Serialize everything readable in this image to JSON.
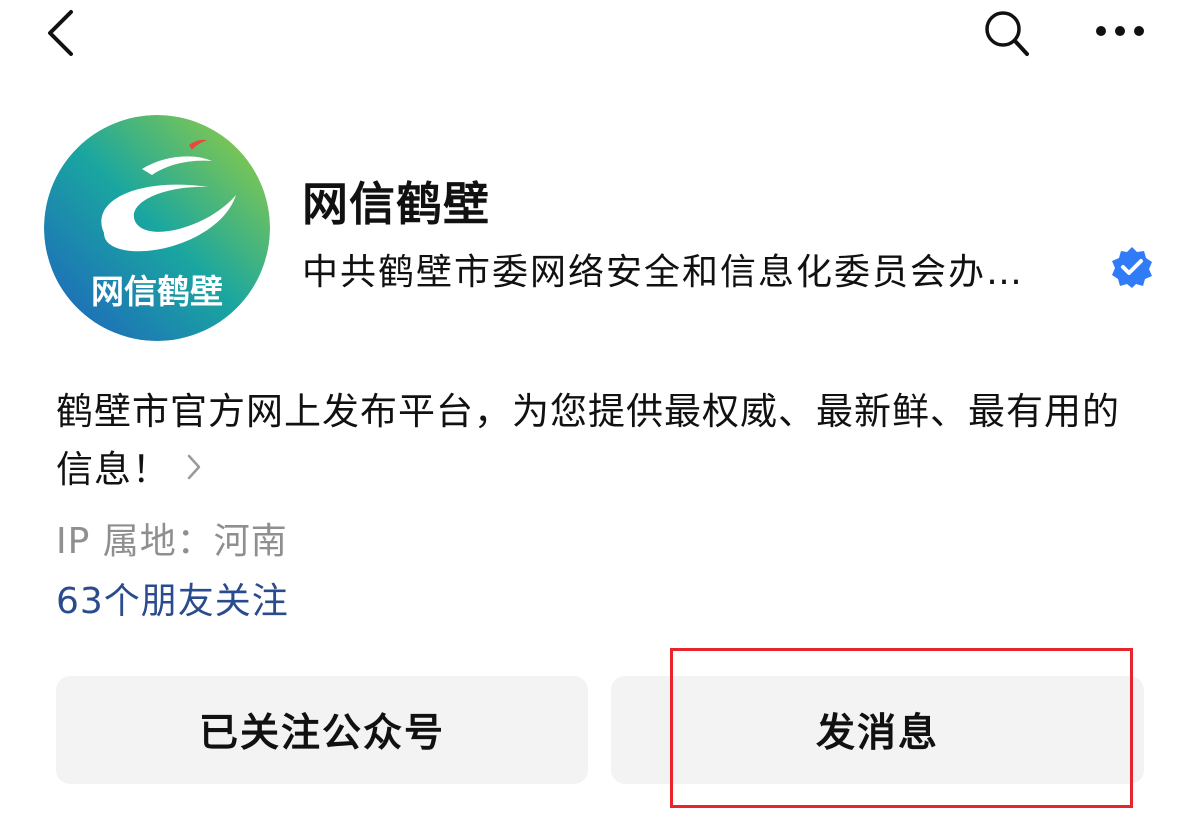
{
  "header": {
    "back_icon": "chevron-left-icon",
    "search_icon": "search-icon",
    "more_icon": "more-dots-icon"
  },
  "profile": {
    "avatar_text": "网信鹤壁",
    "name": "网信鹤壁",
    "owner": "中共鹤壁市委网络安全和信息化委员会办…",
    "verified_color": "#2f7cf6",
    "description": "鹤壁市官方网上发布平台，为您提供最权威、最新鲜、最有用的信息！",
    "ip_location": "IP 属地：河南",
    "friends_following": "63个朋友关注"
  },
  "actions": {
    "follow_label": "已关注公众号",
    "message_label": "发消息"
  },
  "colors": {
    "highlight": "#e8242f",
    "link_blue": "#2a4b8d",
    "button_bg": "#f3f3f3"
  }
}
